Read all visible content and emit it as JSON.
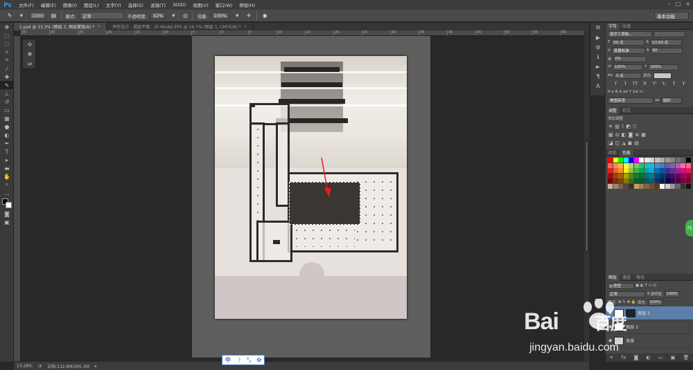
{
  "app": {
    "logo": "Ps",
    "menus": [
      "文件(F)",
      "编辑(E)",
      "图像(I)",
      "图层(L)",
      "文字(Y)",
      "选择(S)",
      "滤镜(T)",
      "3D(D)",
      "视图(V)",
      "窗口(W)",
      "帮助(H)"
    ],
    "window_buttons": [
      "–",
      "□",
      "×"
    ]
  },
  "options": {
    "brush_size": "1000",
    "mode_label": "模式:",
    "mode_value": "正常",
    "opacity_label": "不透明度:",
    "opacity_value": "42%",
    "flow_label": "流量:",
    "flow_value": "100%",
    "workspace": "基本功能"
  },
  "tabs": [
    {
      "label": "1.psd @ 13.3% (图层 3, 图层蒙版/8) *",
      "active": true
    },
    {
      "label": "声控设计 - 楼层平面 - 2F-Model.EPS @ 16.7% (图层 1, CMYK/8) *",
      "active": false
    }
  ],
  "ruler_ticks": [
    "35",
    "30",
    "25",
    "20",
    "15",
    "10",
    "5",
    "0",
    "5",
    "10",
    "15",
    "20",
    "25",
    "30",
    "35",
    "40",
    "45",
    "50",
    "55",
    "60"
  ],
  "character_panel": {
    "tabs": [
      "字符",
      "段落"
    ],
    "font_family": "造字工房新...",
    "font_style": "-",
    "font_size": "59 点",
    "leading": "13.93 点",
    "kerning": "度量标准",
    "tracking": "60",
    "scale_v_label": "0%",
    "scale_h": "100%",
    "scale_v": "100%",
    "baseline": "0 点",
    "color_label": "颜色:",
    "style_buttons": [
      "T",
      "T",
      "TT",
      "Tr",
      "T¹",
      "T₁",
      "T",
      "Ŧ"
    ],
    "language": "美国英语",
    "aa_label": "aa",
    "aa_value": "锐利"
  },
  "adjustments_panel": {
    "tabs": [
      "调整",
      "样式"
    ],
    "title": "添加调整"
  },
  "swatches_panel": {
    "tabs": [
      "颜色",
      "色板"
    ],
    "colors": [
      "#ff0000",
      "#ffff00",
      "#00ff00",
      "#00ffff",
      "#0000ff",
      "#ff00ff",
      "#ffffff",
      "#ebebeb",
      "#d6d6d6",
      "#c2c2c2",
      "#adadad",
      "#999999",
      "#858585",
      "#707070",
      "#5c5c5c",
      "#000000",
      "#f26c4f",
      "#f68e55",
      "#fbaf5c",
      "#fff467",
      "#acd372",
      "#7dc473",
      "#3cb878",
      "#1cbbb4",
      "#00bff3",
      "#438ccb",
      "#5574b9",
      "#605ca9",
      "#855fa8",
      "#a763a9",
      "#f06ea9",
      "#f26d7d",
      "#ed1c24",
      "#f26522",
      "#f7941d",
      "#fff200",
      "#8dc63f",
      "#39b54a",
      "#00a651",
      "#00a99d",
      "#00aeef",
      "#0072bc",
      "#0054a6",
      "#2e3192",
      "#662d91",
      "#92278f",
      "#ec008c",
      "#ed145b",
      "#9e0b0f",
      "#a0410d",
      "#a36209",
      "#aba000",
      "#598527",
      "#197b30",
      "#007236",
      "#00746b",
      "#0076a3",
      "#004b80",
      "#003471",
      "#1b1464",
      "#440e62",
      "#630460",
      "#9e005d",
      "#9e0039",
      "#790000",
      "#7b2e00",
      "#7d4900",
      "#827b00",
      "#406618",
      "#005e20",
      "#005826",
      "#005952",
      "#005b7f",
      "#003663",
      "#002157",
      "#0d004c",
      "#32004b",
      "#4b0049",
      "#7b0046",
      "#7a0026",
      "#c7b299",
      "#998675",
      "#736357",
      "#534741",
      "#37302d",
      "#c69c6d",
      "#a67c52",
      "#8c6239",
      "#754c24",
      "#603913",
      "#ffffff",
      "#cccccc",
      "#999999",
      "#666666",
      "#333333",
      "#111111"
    ]
  },
  "layers_panel": {
    "tabs": [
      "图层",
      "通道",
      "路径"
    ],
    "filter": "p 类型",
    "blend": "正常",
    "opacity_label": "不透明度:",
    "opacity": "100%",
    "lock_label": "锁定:",
    "fill_label": "填充:",
    "fill": "100%",
    "layers": [
      {
        "name": "图层 3",
        "active": true
      },
      {
        "name": "图层 2",
        "active": false
      },
      {
        "name": "背景",
        "active": false
      }
    ]
  },
  "status": {
    "zoom": "13.28%",
    "doc_info": "文档:132.8M/395.3M"
  },
  "ime": {
    "items": [
      "中",
      "☽",
      "°,",
      "✿"
    ]
  },
  "badge": "75",
  "watermark": {
    "main": "Bai",
    "main2": "百度",
    "sub": "jingyan.baidu.com"
  }
}
